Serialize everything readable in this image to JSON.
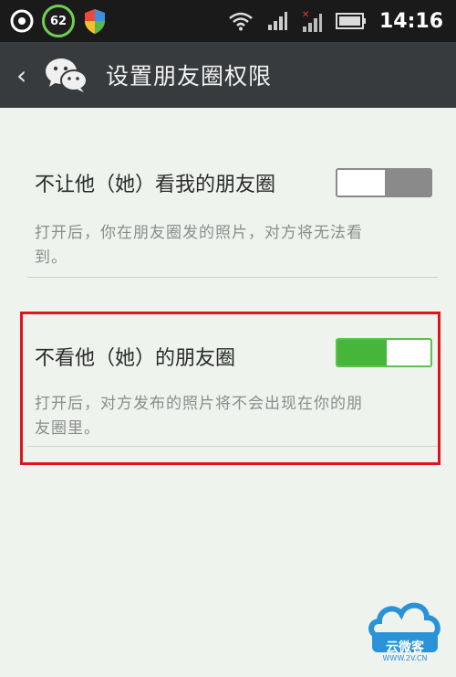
{
  "status_bar": {
    "badge": "62",
    "time": "14:16"
  },
  "header": {
    "title": "设置朋友圈权限"
  },
  "settings": [
    {
      "label": "不让他（她）看我的朋友圈",
      "description_line1": "打开后，你在朋友圈发的照片，对方将无法看",
      "description_line2": "到。",
      "enabled": false
    },
    {
      "label": "不看他（她）的朋友圈",
      "description_line1": "打开后，对方发布的照片将不会出现在你的朋",
      "description_line2": "友圈里。",
      "enabled": true
    }
  ],
  "colors": {
    "switch_on": "#46b63a",
    "switch_off": "#8a8a8a",
    "highlight": "#e0141c"
  },
  "watermark": {
    "text": "云微客",
    "url": "WWW.2V.CN"
  }
}
